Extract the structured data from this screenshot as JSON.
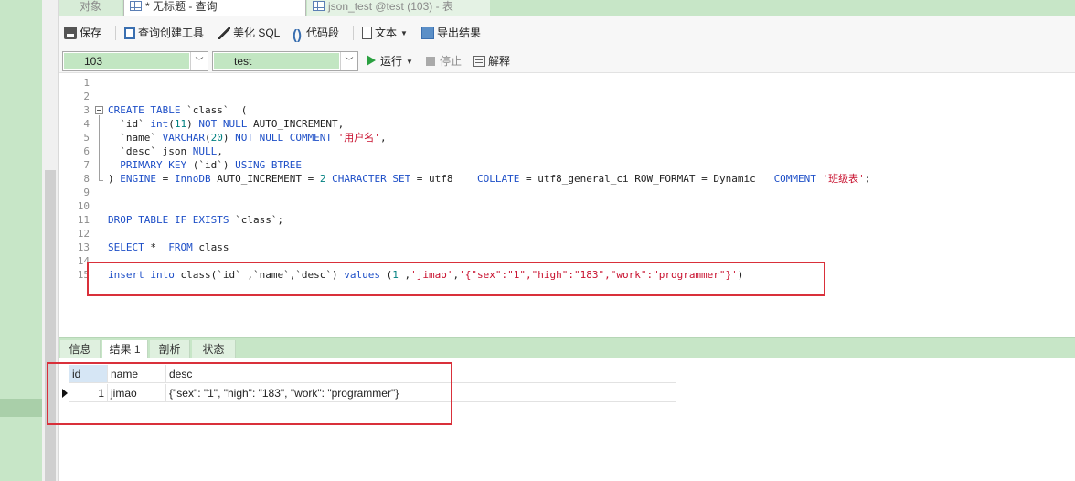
{
  "tabs": [
    {
      "label": "对象"
    },
    {
      "label": "* 无标题 - 查询"
    },
    {
      "label": "json_test @test (103) - 表"
    }
  ],
  "toolbar": {
    "save": "保存",
    "query_builder": "查询创建工具",
    "beautify_sql": "美化 SQL",
    "code_snippet": "代码段",
    "text": "文本",
    "export_results": "导出结果"
  },
  "connbar": {
    "connection": "103",
    "database": "test",
    "run": "运行",
    "stop": "停止",
    "explain": "解释"
  },
  "editor": {
    "line_numbers": [
      "1",
      "2",
      "3",
      "4",
      "5",
      "6",
      "7",
      "8",
      "9",
      "10",
      "11",
      "12",
      "13",
      "14",
      "15"
    ]
  },
  "result_tabs": {
    "info": "信息",
    "result1": "结果 1",
    "profile": "剖析",
    "status": "状态"
  },
  "grid": {
    "columns": [
      "id",
      "name",
      "desc"
    ],
    "rows": [
      {
        "id": "1",
        "name": "jimao",
        "desc": "{\"sex\": \"1\", \"high\": \"183\", \"work\": \"programmer\"}"
      }
    ]
  },
  "colors": {
    "accent_green": "#c7e6c7",
    "keyword_blue": "#1e4fc7",
    "string_red": "#c8102e",
    "highlight_red": "#d9303a"
  }
}
